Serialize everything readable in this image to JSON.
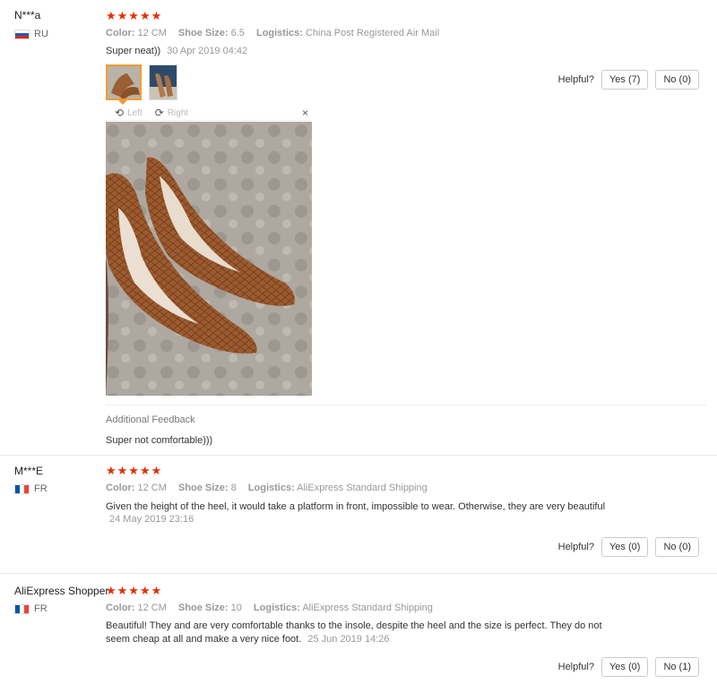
{
  "labels": {
    "color": "Color:",
    "shoe_size": "Shoe Size:",
    "logistics": "Logistics:",
    "helpful": "Helpful?",
    "additional_feedback": "Additional Feedback"
  },
  "viewer": {
    "left_label": "Left",
    "right_label": "Right",
    "close": "×"
  },
  "reviews": [
    {
      "user": "N***a",
      "country": "RU",
      "stars": "★★★★★",
      "rating": 5,
      "color": "12 CM",
      "shoe_size": "6.5",
      "logistics": "China Post Registered Air Mail",
      "text": "Super neat))",
      "date": "30 Apr 2019 04:42",
      "yes": "Yes (7)",
      "no": "No (0)",
      "additional_text": "Super not comfortable)))"
    },
    {
      "user": "M***E",
      "country": "FR",
      "stars": "★★★★★",
      "rating": 5,
      "color": "12 CM",
      "shoe_size": "8",
      "logistics": "AliExpress Standard Shipping",
      "text": "Given the height of the heel, it would take a platform in front, impossible to wear. Otherwise, they are very beautiful",
      "date": "24 May 2019 23:16",
      "yes": "Yes (0)",
      "no": "No (0)"
    },
    {
      "user": "AliExpress Shopper",
      "country": "FR",
      "stars": "★★★★★",
      "rating": 5,
      "color": "12 CM",
      "shoe_size": "10",
      "logistics": "AliExpress Standard Shipping",
      "text_line1": "Beautiful! They and are very comfortable thanks to the insole, despite the heel and the size is perfect. They do not",
      "text_line2": "seem cheap at all and make a very nice foot.",
      "date": "25 Jun 2019 14:26",
      "yes": "Yes (0)",
      "no": "No (1)"
    }
  ],
  "colors": {
    "star": "#e62e04",
    "thumb_active_border": "#f39c30"
  }
}
